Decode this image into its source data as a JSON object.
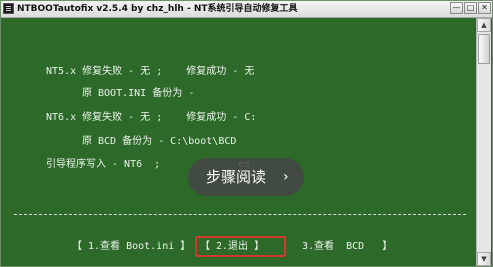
{
  "window": {
    "title": "NTBOOTautofix v2.5.4 by chz_hlh - NT系统引导自动修复工具",
    "controls": {
      "minimize": "—",
      "maximize": "□",
      "close": "✕"
    }
  },
  "console": {
    "lines": [
      "NT5.x 修复失败 - 无 ;    修复成功 - 无",
      "原 BOOT.INI 备份为 -",
      "NT6.x 修复失败 - 无 ;    修复成功 - C:",
      "原 BCD 备份为 - C:\\boot\\BCD",
      "引导程序写入 - NT6  ;             es"
    ],
    "divider": "-----------------------------------------------------------------------"
  },
  "menu": {
    "item1": "【 1.查看 Boot.ini 】",
    "item2": "【 2.退出 】",
    "item3": "3.查看  BCD   】",
    "selected_index": 2
  },
  "overlay": {
    "label": "步骤阅读",
    "chevron": "›"
  },
  "scrollbar": {
    "up": "▲",
    "down": "▼"
  },
  "colors": {
    "console_bg": "#2d6a2a",
    "console_text": "#ecf3ea",
    "highlight_border": "#cf3a2c",
    "overlay_bg": "#464646"
  }
}
